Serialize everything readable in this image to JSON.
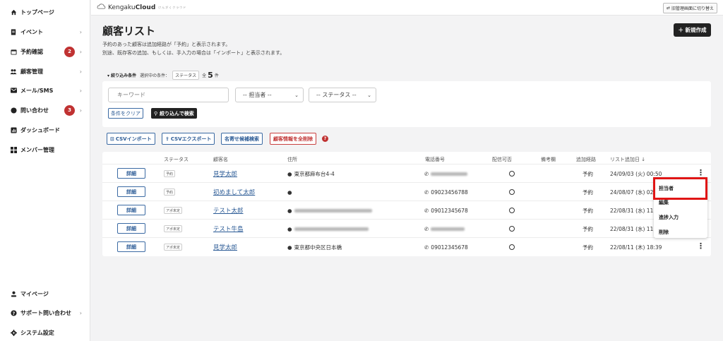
{
  "sidebar": {
    "items": [
      {
        "label": "トップページ",
        "icon": "home-icon"
      },
      {
        "label": "イベント",
        "icon": "document-icon"
      },
      {
        "label": "予約確認",
        "icon": "calendar-icon",
        "badge": "2"
      },
      {
        "label": "顧客管理",
        "icon": "users-icon"
      },
      {
        "label": "メール/SMS",
        "icon": "mail-icon"
      },
      {
        "label": "問い合わせ",
        "icon": "chat-icon",
        "badge": "3"
      },
      {
        "label": "ダッシュボード",
        "icon": "chart-icon"
      },
      {
        "label": "メンバー管理",
        "icon": "grid-icon"
      }
    ],
    "bottom_items": [
      {
        "label": "マイページ",
        "icon": "person-icon"
      },
      {
        "label": "サポート問い合わせ",
        "icon": "help-icon"
      },
      {
        "label": "システム設定",
        "icon": "settings-icon"
      }
    ]
  },
  "topbar": {
    "logo_light": "Kengaku",
    "logo_bold": "Cloud",
    "logo_tagline": "けんがくクラウド",
    "admin_switch": "旧管理画面に切り替え"
  },
  "header": {
    "title": "顧客リスト",
    "desc_line1": "予約のあった顧客は追加経路が「予約」と表示されます。",
    "desc_line2": "別途、既存客の追加、もしくは、手入力の場合は「インポート」と表示されます。",
    "new_button": "＋ 新規作成"
  },
  "filter": {
    "toggle_label": "▾ 絞り込み条件",
    "selected_label": "選択中の条件：",
    "selected_chip": "ステータス",
    "count_prefix": "全",
    "count": "5",
    "count_suffix": "件",
    "keyword_placeholder": "キーワード",
    "assignee_select": "-- 担当者 --",
    "status_select": "-- ステータス --",
    "clear_button": "条件をクリア",
    "search_button": "絞り込んで検索"
  },
  "actions": {
    "csv_import": "CSVインポート",
    "csv_export": "CSVエクスポート",
    "name_search": "名寄せ候補検索",
    "delete_all": "顧客情報を全削除"
  },
  "table": {
    "headers": [
      "ステータス",
      "顧客名",
      "住所",
      "電話番号",
      "配信可否",
      "備考欄",
      "追加経路",
      "リスト追加日 ↓"
    ],
    "detail_label": "詳細",
    "rows": [
      {
        "status": "予約",
        "name": "見学太郎",
        "address": "東京都麻布台4-4",
        "phone": "",
        "route": "予約",
        "date": "24/09/03 (火) 00:50"
      },
      {
        "status": "予約",
        "name": "初めまして太郎",
        "address": "",
        "phone": "09023456788",
        "route": "予約",
        "date": "24/08/07 (水) 02:"
      },
      {
        "status": "アポ未定",
        "name": "テスト太郎",
        "address": "",
        "phone": "09012345678",
        "route": "予約",
        "date": "22/08/31 (水) 11:5"
      },
      {
        "status": "アポ未定",
        "name": "テスト牛島",
        "address": "",
        "phone": "",
        "route": "予約",
        "date": "22/08/31 (水) 11:5"
      },
      {
        "status": "アポ未定",
        "name": "見学太郎",
        "address": "東京都中央区日本橋",
        "phone": "09012345678",
        "route": "予約",
        "date": "22/08/11 (木) 18:39"
      }
    ]
  },
  "row_menu": {
    "items": [
      "担当者",
      "編集",
      "進捗入力",
      "削除"
    ]
  },
  "colors": {
    "accent": "#2a5a95",
    "danger": "#c03232",
    "highlight": "#e01515"
  }
}
